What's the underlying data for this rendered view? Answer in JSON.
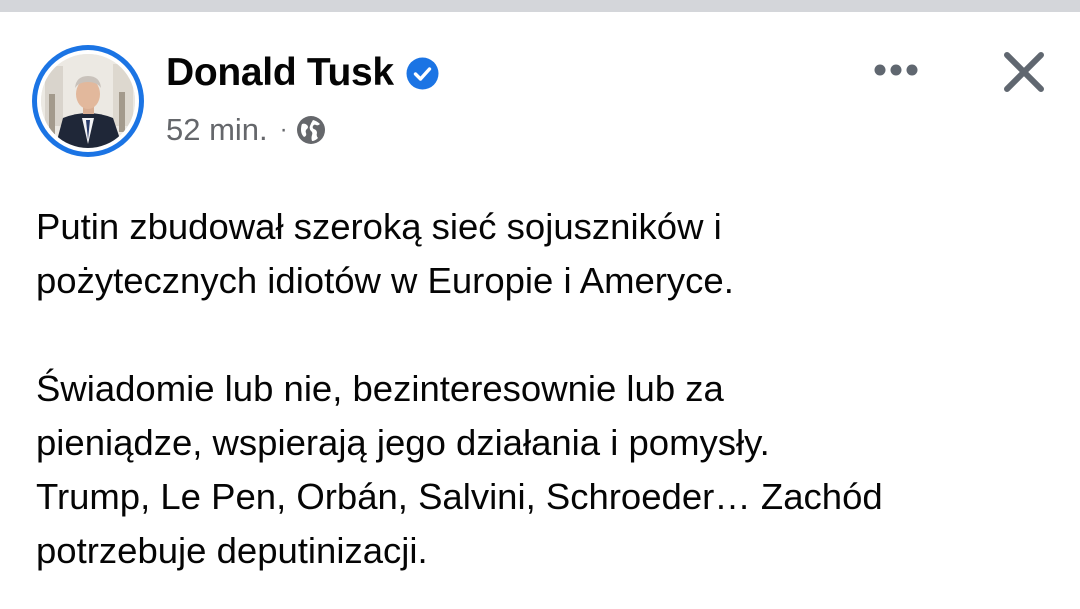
{
  "post": {
    "author_name": "Donald Tusk",
    "verified": true,
    "timestamp": "52 min.",
    "separator": "·",
    "audience_icon": "globe-icon",
    "more_icon": "more-horizontal-icon",
    "close_icon": "close-icon",
    "paragraphs": [
      {
        "lines": [
          "Putin zbudował szeroką sieć sojuszników i",
          "pożytecznych idiotów w Europie i Ameryce."
        ]
      },
      {
        "lines": [
          "Świadomie lub nie, bezinteresownie lub za",
          "pieniądze, wspierają jego działania i pomysły.",
          "Trump, Le Pen, Orbán, Salvini, Schroeder… Zachód",
          "potrzebuje deputinizacji."
        ]
      }
    ]
  },
  "colors": {
    "accent": "#1b74e4",
    "text_primary": "#050505",
    "text_secondary": "#65676b",
    "top_strip": "#d4d6da"
  }
}
